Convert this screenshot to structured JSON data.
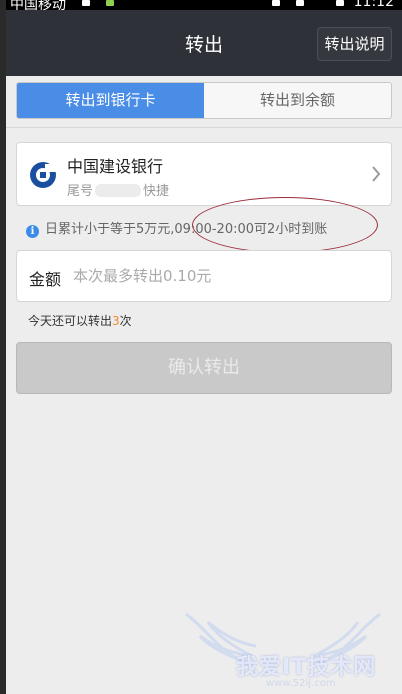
{
  "statusbar": {
    "carrier": "中国移动",
    "time": "11:12"
  },
  "header": {
    "title": "转出",
    "help_button": "转出说明"
  },
  "tabs": [
    {
      "label": "转出到银行卡",
      "active": true
    },
    {
      "label": "转出到余额",
      "active": false
    }
  ],
  "bank": {
    "name": "中国建设银行",
    "tail_prefix": "尾号",
    "tail_suffix": "快捷"
  },
  "info": {
    "text": "日累计小于等于5万元,09:00-20:00可2小时到账"
  },
  "amount": {
    "label": "金额",
    "placeholder": "本次最多转出0.10元",
    "value": ""
  },
  "remaining": {
    "prefix": "今天还可以转出",
    "count": "3",
    "suffix": "次"
  },
  "confirm_button": "确认转出",
  "watermark": {
    "text": "我爱IT技术网",
    "url": "www.52ij.com"
  },
  "colors": {
    "accent": "#4a8de6",
    "header_bg": "#2e3137",
    "annotation": "#9c2b3a",
    "highlight_count": "#f08c2a"
  }
}
